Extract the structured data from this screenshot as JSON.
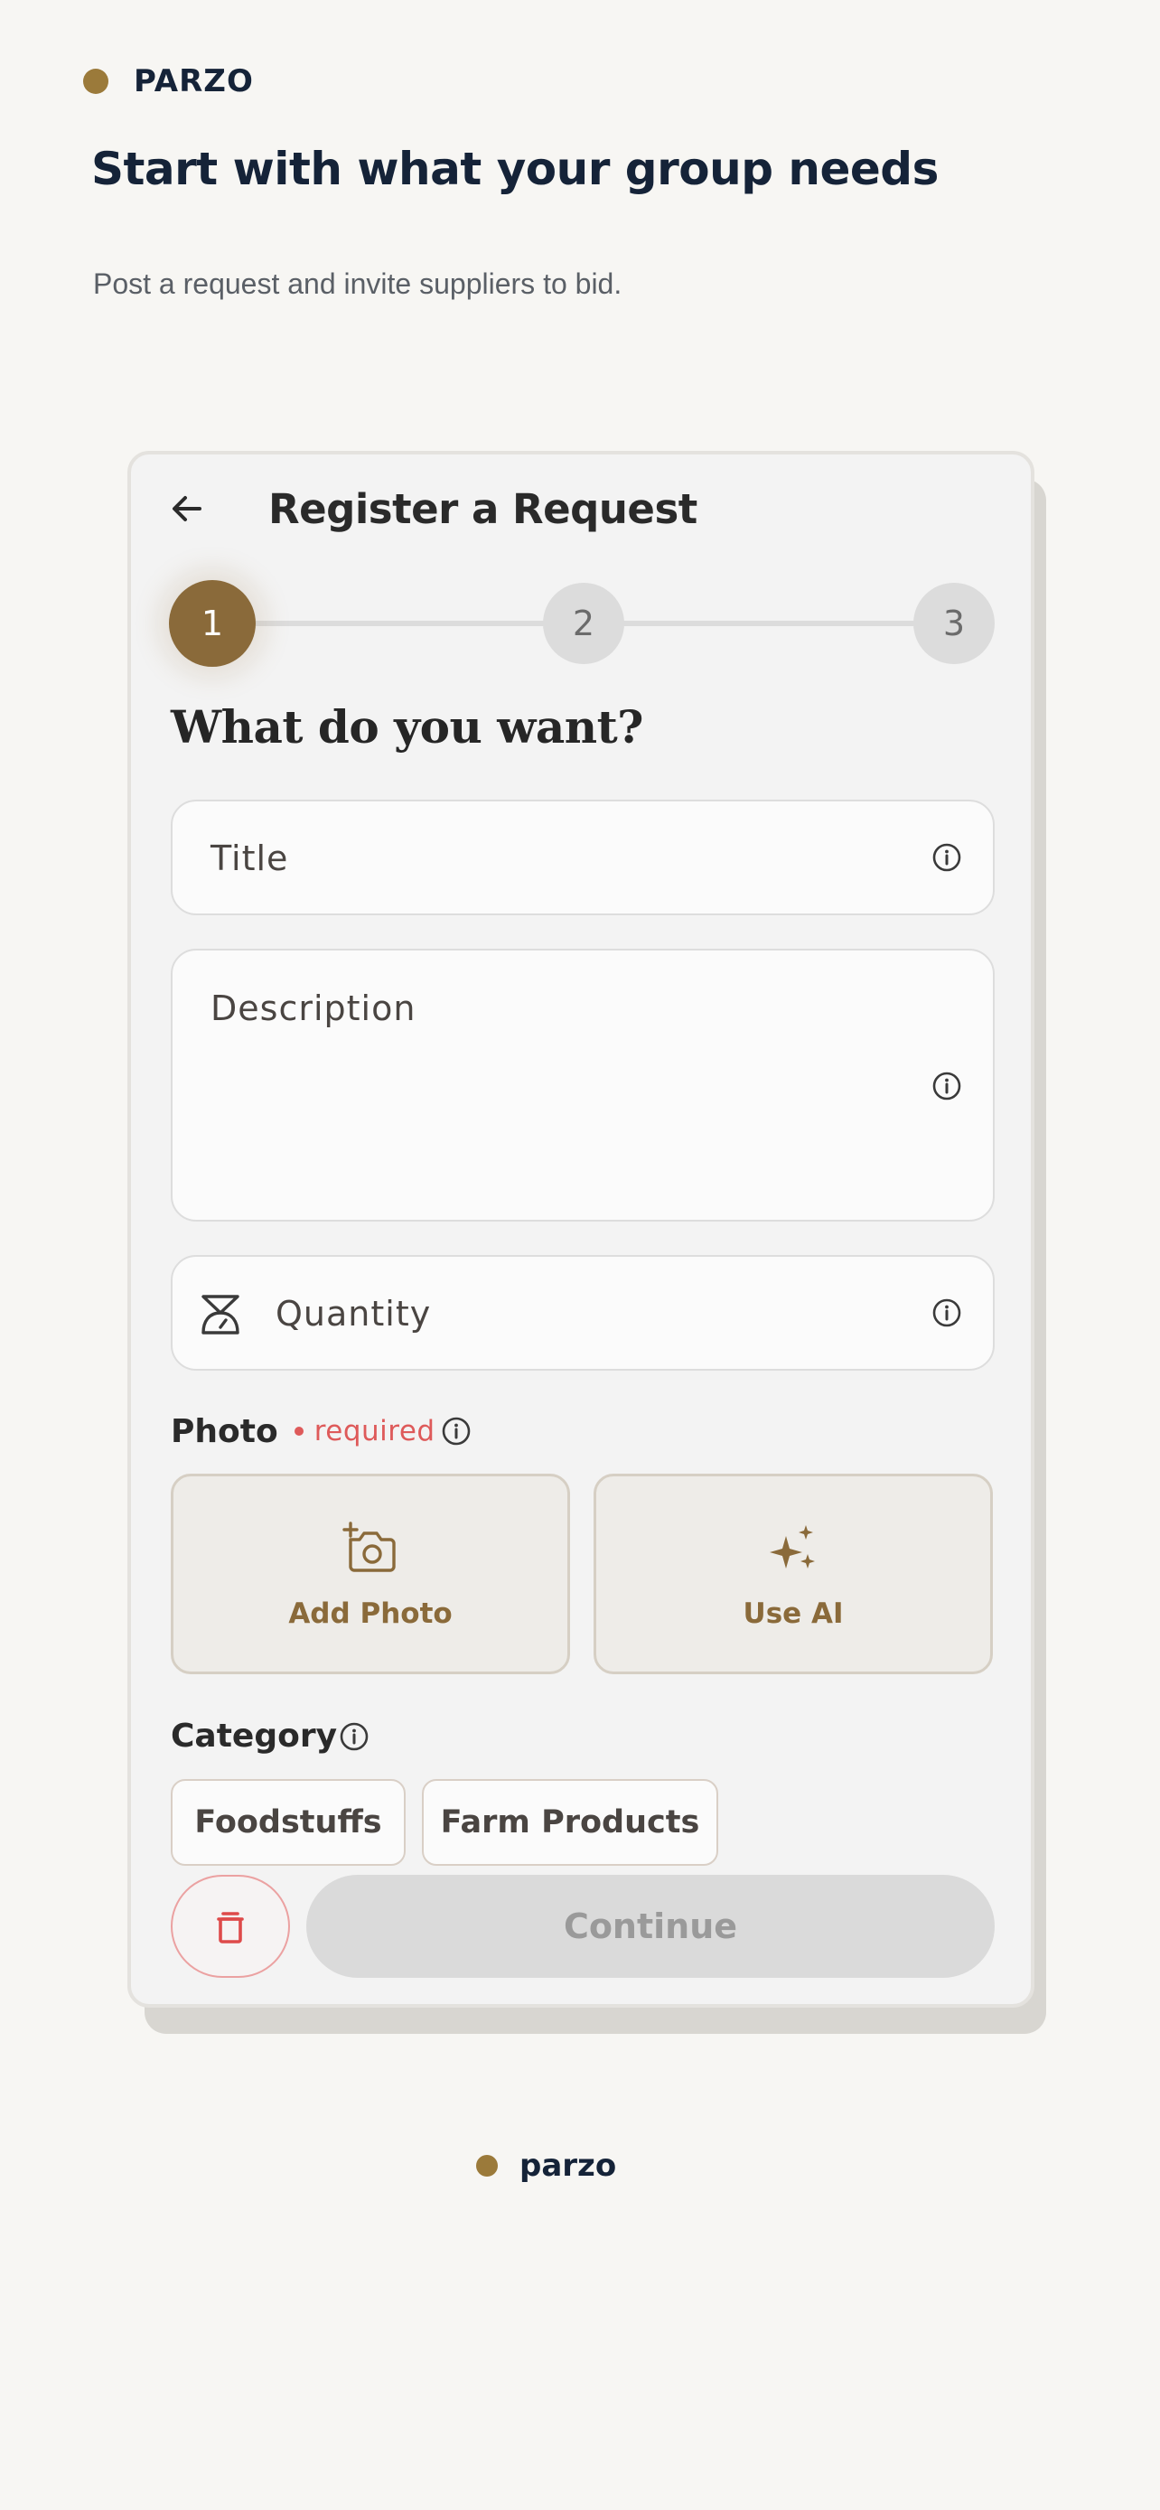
{
  "page": {
    "brand_top": "PARZO",
    "headline": "Start with what your group needs",
    "subline": "Post a request and invite suppliers to bid.",
    "brand_bottom": "parzo",
    "accent_color": "#8a6a3a",
    "navy_color": "#152338"
  },
  "card": {
    "back_icon": "arrow-left-icon",
    "title": "Register a Request",
    "steps": [
      "1",
      "2",
      "3"
    ],
    "active_step": 1,
    "question": "What do you want?",
    "fields": {
      "title_placeholder": "Title",
      "description_placeholder": "Description",
      "quantity_placeholder": "Quantity",
      "quantity_icon": "scale-icon",
      "info_icon": "info-icon"
    },
    "photo": {
      "label": "Photo",
      "required_text": "required",
      "add_photo_label": "Add Photo",
      "add_photo_icon": "add-camera-icon",
      "use_ai_label": "Use AI",
      "use_ai_icon": "sparkles-icon"
    },
    "category": {
      "label": "Category",
      "chips": [
        "Foodstuffs",
        "Farm Products"
      ]
    },
    "actions": {
      "delete_icon": "trash-icon",
      "continue_label": "Continue",
      "delete_color": "#de4a4a"
    }
  }
}
